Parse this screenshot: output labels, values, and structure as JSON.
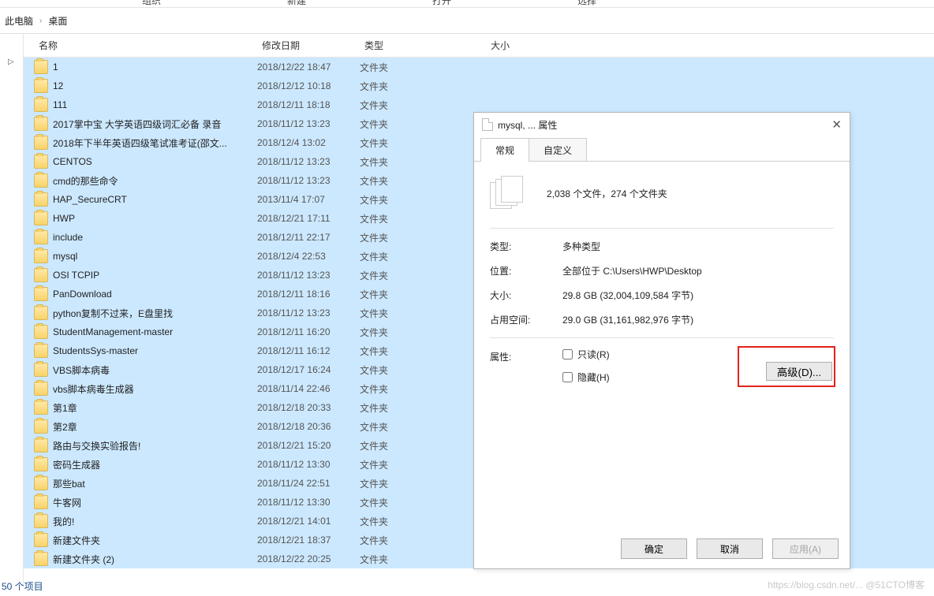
{
  "ribbon": {
    "c0": "组织",
    "c1": "新建",
    "c2": "打开",
    "c3": "选择"
  },
  "breadcrumb": {
    "part0": "此电脑",
    "part1": "桌面"
  },
  "columns": {
    "name": "名称",
    "date": "修改日期",
    "type": "类型",
    "size": "大小"
  },
  "rows": [
    {
      "name": "1",
      "date": "2018/12/22 18:47",
      "type": "文件夹"
    },
    {
      "name": "12",
      "date": "2018/12/12 10:18",
      "type": "文件夹"
    },
    {
      "name": "111",
      "date": "2018/12/11 18:18",
      "type": "文件夹"
    },
    {
      "name": "2017掌中宝 大学英语四级词汇必备 录音",
      "date": "2018/11/12 13:23",
      "type": "文件夹"
    },
    {
      "name": "2018年下半年英语四级笔试准考证(邵文...",
      "date": "2018/12/4 13:02",
      "type": "文件夹"
    },
    {
      "name": "CENTOS",
      "date": "2018/11/12 13:23",
      "type": "文件夹"
    },
    {
      "name": "cmd的那些命令",
      "date": "2018/11/12 13:23",
      "type": "文件夹"
    },
    {
      "name": "HAP_SecureCRT",
      "date": "2013/11/4 17:07",
      "type": "文件夹"
    },
    {
      "name": "HWP",
      "date": "2018/12/21 17:11",
      "type": "文件夹"
    },
    {
      "name": "include",
      "date": "2018/12/11 22:17",
      "type": "文件夹"
    },
    {
      "name": "mysql",
      "date": "2018/12/4 22:53",
      "type": "文件夹"
    },
    {
      "name": "OSI TCPIP",
      "date": "2018/11/12 13:23",
      "type": "文件夹"
    },
    {
      "name": "PanDownload",
      "date": "2018/12/11 18:16",
      "type": "文件夹"
    },
    {
      "name": "python复制不过来，E盘里找",
      "date": "2018/11/12 13:23",
      "type": "文件夹"
    },
    {
      "name": "StudentManagement-master",
      "date": "2018/12/11 16:20",
      "type": "文件夹"
    },
    {
      "name": "StudentsSys-master",
      "date": "2018/12/11 16:12",
      "type": "文件夹"
    },
    {
      "name": "VBS脚本病毒",
      "date": "2018/12/17 16:24",
      "type": "文件夹"
    },
    {
      "name": "vbs脚本病毒生成器",
      "date": "2018/11/14 22:46",
      "type": "文件夹"
    },
    {
      "name": "第1章",
      "date": "2018/12/18 20:33",
      "type": "文件夹"
    },
    {
      "name": "第2章",
      "date": "2018/12/18 20:36",
      "type": "文件夹"
    },
    {
      "name": "路由与交换实验报告!",
      "date": "2018/12/21 15:20",
      "type": "文件夹"
    },
    {
      "name": "密码生成器",
      "date": "2018/11/12 13:30",
      "type": "文件夹"
    },
    {
      "name": "那些bat",
      "date": "2018/11/24 22:51",
      "type": "文件夹"
    },
    {
      "name": "牛客网",
      "date": "2018/11/12 13:30",
      "type": "文件夹"
    },
    {
      "name": "我的!",
      "date": "2018/12/21 14:01",
      "type": "文件夹"
    },
    {
      "name": "新建文件夹",
      "date": "2018/12/21 18:37",
      "type": "文件夹"
    },
    {
      "name": "新建文件夹 (2)",
      "date": "2018/12/22 20:25",
      "type": "文件夹"
    }
  ],
  "status": "50 个项目",
  "watermark": "https://blog.csdn.net/... @51CTO博客",
  "dialog": {
    "title": "mysql, ... 属性",
    "tabs": {
      "general": "常规",
      "custom": "自定义"
    },
    "summary": "2,038 个文件，274 个文件夹",
    "type_label": "类型:",
    "type_value": "多种类型",
    "loc_label": "位置:",
    "loc_value": "全部位于 C:\\Users\\HWP\\Desktop",
    "size_label": "大小:",
    "size_value": "29.8 GB (32,004,109,584 字节)",
    "disk_label": "占用空间:",
    "disk_value": "29.0 GB (31,161,982,976 字节)",
    "attr_label": "属性:",
    "readonly": "只读(R)",
    "hidden": "隐藏(H)",
    "advanced": "高级(D)...",
    "ok": "确定",
    "cancel": "取消",
    "apply": "应用(A)"
  }
}
